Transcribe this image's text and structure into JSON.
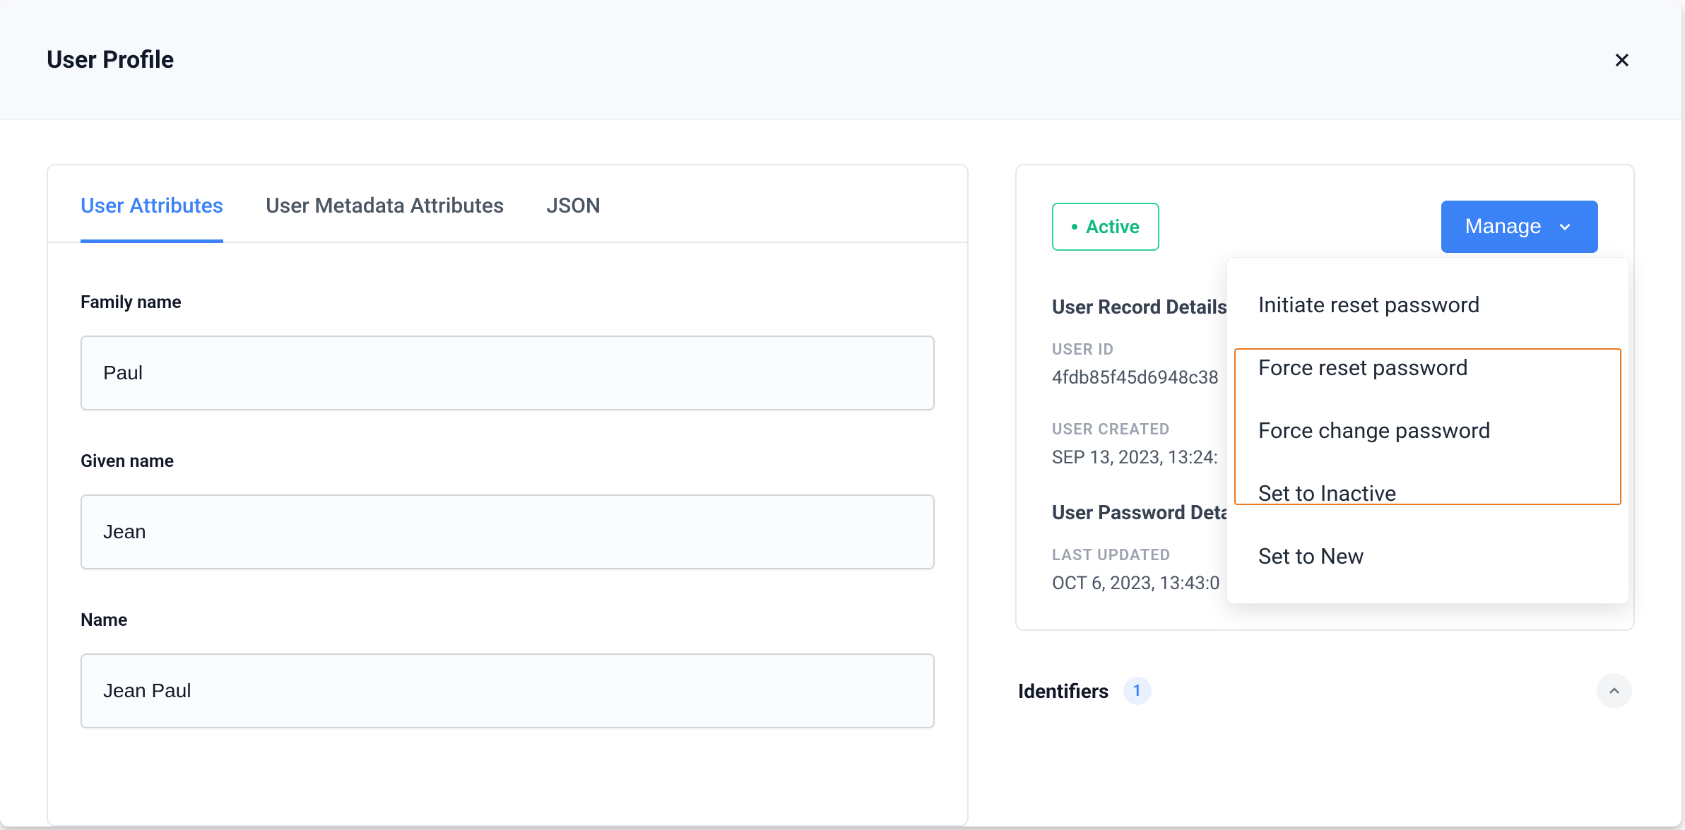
{
  "header": {
    "title": "User Profile"
  },
  "tabs": [
    {
      "label": "User Attributes"
    },
    {
      "label": "User Metadata Attributes"
    },
    {
      "label": "JSON"
    }
  ],
  "form": {
    "family_name": {
      "label": "Family name",
      "value": "Paul"
    },
    "given_name": {
      "label": "Given name",
      "value": "Jean"
    },
    "name": {
      "label": "Name",
      "value": "Jean Paul"
    }
  },
  "status": {
    "badge": "Active",
    "manage_label": "Manage",
    "record_heading": "User Record Details",
    "user_id_label": "USER ID",
    "user_id_value": "4fdb85f45d6948c38",
    "user_created_label": "USER CREATED",
    "user_created_value": "SEP 13, 2023, 13:24:",
    "password_heading": "User Password Details",
    "last_updated_label": "LAST UPDATED",
    "last_updated_value": "OCT 6, 2023, 13:43:0"
  },
  "manage_menu": [
    {
      "label": "Initiate reset password"
    },
    {
      "label": "Force reset password"
    },
    {
      "label": "Force change password"
    },
    {
      "label": "Set to Inactive"
    },
    {
      "label": "Set to New"
    }
  ],
  "identifiers": {
    "title": "Identifiers",
    "count": "1"
  }
}
